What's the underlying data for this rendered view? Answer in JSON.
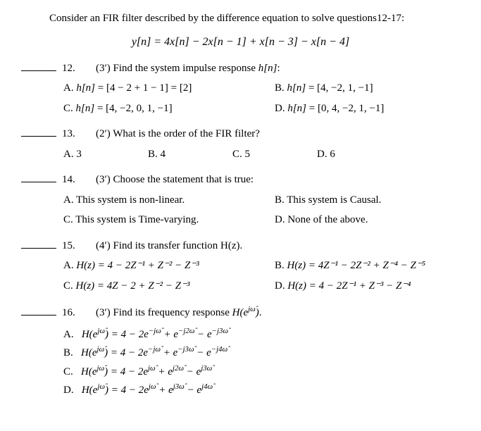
{
  "intro": "Consider an FIR filter described by the difference equation to solve questions12-17:",
  "equation": "y[n]  =   4x[n] − 2x[n − 1] + x[n − 3] − x[n − 4]",
  "q12": {
    "num": "12.",
    "prompt": "(3′) Find the system impulse response ",
    "promptVar": "h[n]",
    "promptEnd": ":",
    "A_pre": "A. ",
    "A_var": "h[n]",
    "A_post": "  =  [4 − 2 + 1 − 1] = [2]",
    "B_pre": "B. ",
    "B_var": "h[n]",
    "B_post": "  =  [4, −2, 1, −1]",
    "C_pre": "C. ",
    "C_var": "h[n]",
    "C_post": "  =  [4, −2, 0, 1, −1]",
    "D_pre": "D. ",
    "D_var": "h[n]",
    "D_post": "  =  [0, 4, −2, 1, −1]"
  },
  "q13": {
    "num": "13.",
    "prompt": "(2′) What is the order of the FIR filter?",
    "A": "A. 3",
    "B": "B.  4",
    "C": "C. 5",
    "D": "D. 6"
  },
  "q14": {
    "num": "14.",
    "prompt": "(3′) Choose the statement that is true:",
    "A": "A. This system is non-linear.",
    "B": "B. This system is Causal.",
    "C": "C. This system is Time-varying.",
    "D": "D. None of the above."
  },
  "q15": {
    "num": "15.",
    "prompt": "(4′) Find its transfer function H(z).",
    "A_pre": "A. ",
    "A_math": "H(z) = 4 − 2Z⁻¹ + Z⁻² − Z⁻³",
    "B_pre": "B. ",
    "B_math": "H(z) = 4Z⁻¹ − 2Z⁻² + Z⁻⁴ − Z⁻⁵",
    "C_pre": "C. ",
    "C_math": "H(z) = 4Z − 2 + Z⁻² − Z⁻³",
    "D_pre": "D. ",
    "D_math": "H(z) = 4 − 2Z⁻¹ + Z⁻³ − Z⁻⁴"
  },
  "q16": {
    "num": "16.",
    "prompt_pre": "(3′) Find its frequency response ",
    "prompt_post": ".",
    "Hlabel": "H(e^{jω̂})",
    "A": "A.   H(e^{jω̂}) = 4 − 2e^{−jω̂} + e^{−j2ω̂} − e^{−j3ω̂}",
    "B": "B.   H(e^{jω̂}) = 4 − 2e^{−jω̂} + e^{−j3ω̂} − e^{−j4ω̂}",
    "C": "C.   H(e^{jω̂}) = 4 − 2e^{jω̂} + e^{j2ω̂} − e^{j3ω̂}",
    "D": "D.   H(e^{jω̂}) = 4 − 2e^{jω̂} + e^{j3ω̂} − e^{j4ω̂}"
  }
}
